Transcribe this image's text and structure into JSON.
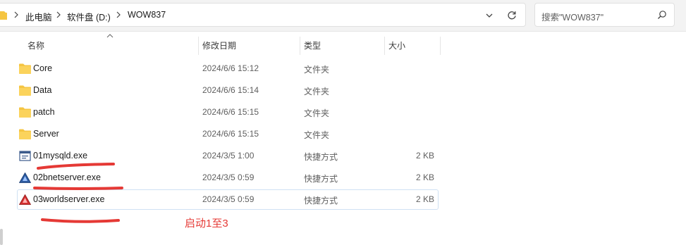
{
  "address_bar": {
    "breadcrumbs": [
      "此电脑",
      "软件盘 (D:)",
      "WOW837"
    ]
  },
  "search": {
    "placeholder": "搜索\"WOW837\""
  },
  "columns": [
    "名称",
    "修改日期",
    "类型",
    "大小"
  ],
  "files": [
    {
      "name": "Core",
      "modified": "2024/6/6 15:12",
      "type": "文件夹",
      "size": "",
      "icon": "folder-icon"
    },
    {
      "name": "Data",
      "modified": "2024/6/6 15:14",
      "type": "文件夹",
      "size": "",
      "icon": "folder-icon"
    },
    {
      "name": "patch",
      "modified": "2024/6/6 15:15",
      "type": "文件夹",
      "size": "",
      "icon": "folder-icon"
    },
    {
      "name": "Server",
      "modified": "2024/6/6 15:15",
      "type": "文件夹",
      "size": "",
      "icon": "folder-icon"
    },
    {
      "name": "01mysqld.exe",
      "modified": "2024/3/5 1:00",
      "type": "快捷方式",
      "size": "2 KB",
      "icon": "app-shortcut-icon"
    },
    {
      "name": "02bnetserver.exe",
      "modified": "2024/3/5 0:59",
      "type": "快捷方式",
      "size": "2 KB",
      "icon": "bnet-shortcut-icon"
    },
    {
      "name": "03worldserver.exe",
      "modified": "2024/3/5 0:59",
      "type": "快捷方式",
      "size": "2 KB",
      "icon": "world-shortcut-icon"
    }
  ],
  "annotation": {
    "text": "启动1至3",
    "color": "#e53935"
  },
  "colors": {
    "folder": "#f5c542",
    "selection_border": "#cfe1f3",
    "annotation": "#e53935"
  }
}
